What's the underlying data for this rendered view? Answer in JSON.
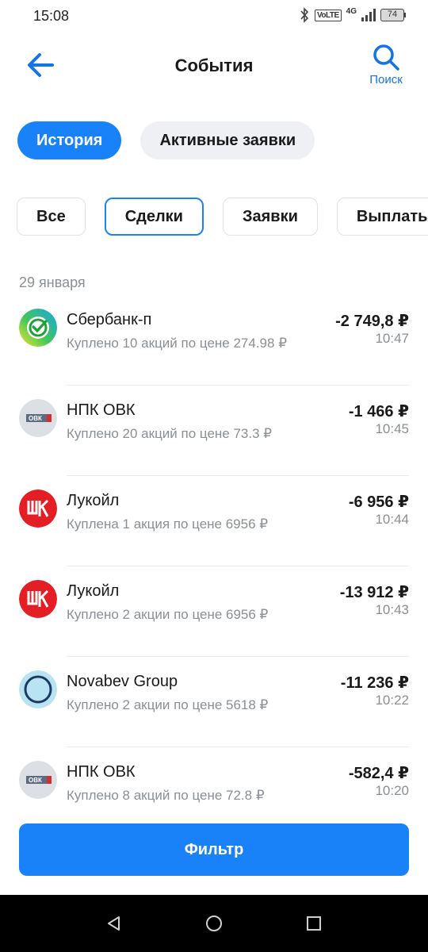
{
  "status_bar": {
    "time": "15:08",
    "volte": "VoLTE",
    "network": "4G",
    "battery": "74"
  },
  "header": {
    "title": "События",
    "search_label": "Поиск",
    "back_icon": "arrow-left-icon",
    "search_icon": "search-icon"
  },
  "top_tabs": [
    {
      "label": "История",
      "active": true
    },
    {
      "label": "Активные заявки",
      "active": false
    }
  ],
  "filter_chips": [
    {
      "label": "Все",
      "selected": false
    },
    {
      "label": "Сделки",
      "selected": true
    },
    {
      "label": "Заявки",
      "selected": false
    },
    {
      "label": "Выплаты",
      "selected": false
    }
  ],
  "date_header": "29 января",
  "transactions": [
    {
      "name": "Сбербанк-п",
      "desc": "Куплено 10 акций по цене 274.98 ₽",
      "amount": "-2 749,8 ₽",
      "time": "10:47",
      "logo": "sberbank-logo"
    },
    {
      "name": "НПК ОВК",
      "desc": "Куплено 20 акций по цене 73.3 ₽",
      "amount": "-1 466 ₽",
      "time": "10:45",
      "logo": "ovk-logo"
    },
    {
      "name": "Лукойл",
      "desc": "Куплена 1 акция по цене 6956 ₽",
      "amount": "-6 956 ₽",
      "time": "10:44",
      "logo": "lukoil-logo"
    },
    {
      "name": "Лукойл",
      "desc": "Куплено 2 акции по цене 6956 ₽",
      "amount": "-13 912 ₽",
      "time": "10:43",
      "logo": "lukoil-logo"
    },
    {
      "name": "Novabev Group",
      "desc": "Куплено 2 акции по цене 5618 ₽",
      "amount": "-11 236 ₽",
      "time": "10:22",
      "logo": "novabev-logo"
    },
    {
      "name": "НПК ОВК",
      "desc": "Куплено 8 акций по цене 72.8 ₽",
      "amount": "-582,4 ₽",
      "time": "10:20",
      "logo": "ovk-logo"
    }
  ],
  "filter_button": "Фильтр",
  "colors": {
    "accent": "#1a82f8",
    "link": "#1473e6",
    "secondary_text": "#8a8f96",
    "lukoil_red": "#e31e24"
  }
}
